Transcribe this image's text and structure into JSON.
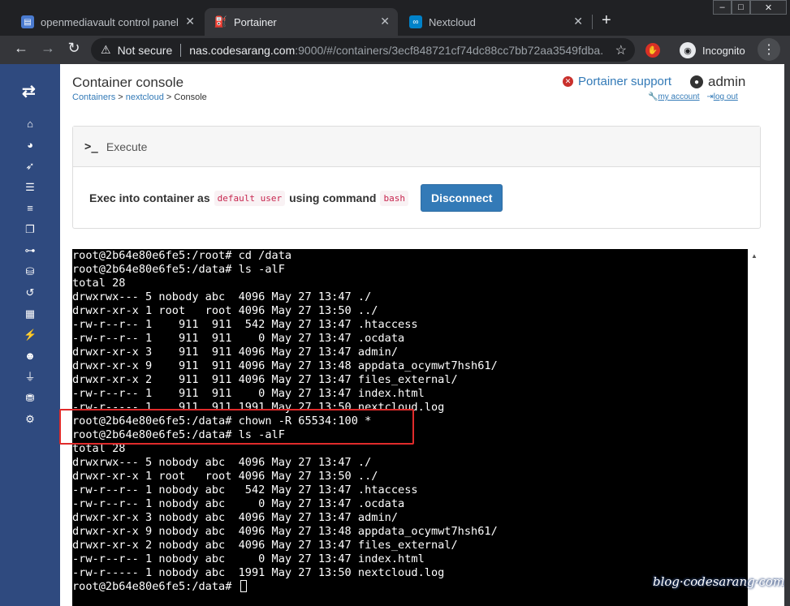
{
  "browser": {
    "tabs": [
      {
        "title": "openmediavault control panel - c",
        "icon": "omv-icon",
        "color": "#4a7bd0"
      },
      {
        "title": "Portainer",
        "icon": "portainer-icon",
        "color": "#13bef9"
      },
      {
        "title": "Nextcloud",
        "icon": "nextcloud-icon",
        "color": "#0082c9"
      }
    ],
    "window_controls": [
      "–",
      "□",
      "✕"
    ],
    "security_label": "Not secure",
    "url_host": "nas.codesarang.com",
    "url_rest": ":9000/#/containers/3ecf848721cf74dc88cc7bb72aa3549fdba...",
    "incognito_label": "Incognito"
  },
  "header": {
    "title": "Container console",
    "breadcrumb": [
      "Containers",
      "nextcloud",
      "Console"
    ],
    "support_label": "Portainer support",
    "user": "admin",
    "my_account": "my account",
    "log_out": "log out"
  },
  "panel": {
    "title": "Execute",
    "text_exec": "Exec into container as",
    "user_code": "default user",
    "text_cmd": "using command",
    "cmd_code": "bash",
    "button": "Disconnect"
  },
  "terminal": {
    "lines": [
      "root@2b64e80e6fe5:/root# cd /data",
      "root@2b64e80e6fe5:/data# ls -alF",
      "total 28",
      "drwxrwx--- 5 nobody abc  4096 May 27 13:47 ./",
      "drwxr-xr-x 1 root   root 4096 May 27 13:50 ../",
      "-rw-r--r-- 1    911  911  542 May 27 13:47 .htaccess",
      "-rw-r--r-- 1    911  911    0 May 27 13:47 .ocdata",
      "drwxr-xr-x 3    911  911 4096 May 27 13:47 admin/",
      "drwxr-xr-x 9    911  911 4096 May 27 13:48 appdata_ocymwt7hsh61/",
      "drwxr-xr-x 2    911  911 4096 May 27 13:47 files_external/",
      "-rw-r--r-- 1    911  911    0 May 27 13:47 index.html",
      "-rw-r----- 1    911  911 1991 May 27 13:50 nextcloud.log",
      "root@2b64e80e6fe5:/data# chown -R 65534:100 *",
      "root@2b64e80e6fe5:/data# ls -alF",
      "total 28",
      "drwxrwx--- 5 nobody abc  4096 May 27 13:47 ./",
      "drwxr-xr-x 1 root   root 4096 May 27 13:50 ../",
      "-rw-r--r-- 1 nobody abc   542 May 27 13:47 .htaccess",
      "-rw-r--r-- 1 nobody abc     0 May 27 13:47 .ocdata",
      "drwxr-xr-x 3 nobody abc  4096 May 27 13:47 admin/",
      "drwxr-xr-x 9 nobody abc  4096 May 27 13:48 appdata_ocymwt7hsh61/",
      "drwxr-xr-x 2 nobody abc  4096 May 27 13:47 files_external/",
      "-rw-r--r-- 1 nobody abc     0 May 27 13:47 index.html",
      "-rw-r----- 1 nobody abc  1991 May 27 13:50 nextcloud.log"
    ],
    "prompt": "root@2b64e80e6fe5:/data# "
  },
  "sidebar_icons": [
    "home-icon",
    "dashboard-icon",
    "templates-icon",
    "stacks-icon",
    "containers-icon",
    "images-icon",
    "networks-icon",
    "volumes-icon",
    "events-icon",
    "engine-icon",
    "endpoints-icon",
    "users-icon",
    "registries-icon",
    "settings-icon"
  ],
  "watermark": "blog·codesarang·com",
  "colors": {
    "sidebar": "#2f4a7f",
    "primary": "#337ab7",
    "highlight": "#e02b2b"
  }
}
